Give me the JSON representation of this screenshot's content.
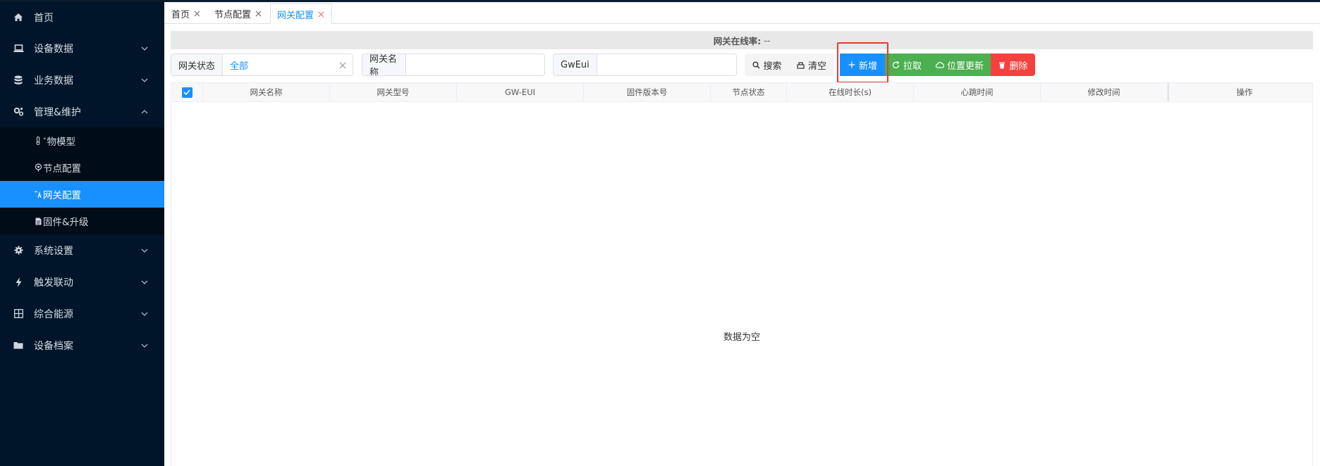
{
  "sidebar": {
    "items": [
      {
        "label": "首页",
        "icon": "home-icon",
        "has_chevron": false
      },
      {
        "label": "设备数据",
        "icon": "laptop-icon",
        "has_chevron": true
      },
      {
        "label": "业务数据",
        "icon": "database-icon",
        "has_chevron": true
      },
      {
        "label": "管理&维护",
        "icon": "cogs-icon",
        "has_chevron": true,
        "expanded": true
      }
    ],
    "sub_items": [
      {
        "label": "物模型",
        "icon": "thermometer-icon",
        "icon_glyph": "🌡"
      },
      {
        "label": "节点配置",
        "icon": "node-icon",
        "icon_glyph": "◎"
      },
      {
        "label": "网关配置",
        "icon": "gateway-icon",
        "icon_glyph": "⟟",
        "active": true
      },
      {
        "label": "固件&升级",
        "icon": "file-icon",
        "icon_glyph": "▤"
      }
    ],
    "items_after": [
      {
        "label": "系统设置",
        "icon": "gear-icon"
      },
      {
        "label": "触发联动",
        "icon": "bolt-icon"
      },
      {
        "label": "综合能源",
        "icon": "grid-icon"
      },
      {
        "label": "设备档案",
        "icon": "folder-icon"
      }
    ]
  },
  "tabs": [
    {
      "label": "首页"
    },
    {
      "label": "节点配置"
    },
    {
      "label": "网关配置",
      "active": true
    }
  ],
  "rate": {
    "label": "网关在线率:",
    "value": "--"
  },
  "filters": {
    "status_label": "网关状态",
    "status_value": "全部",
    "name_label": "网关名称",
    "name_value": "",
    "gweui_label": "GwEui",
    "gweui_value": ""
  },
  "buttons": {
    "search": "搜索",
    "clear": "清空",
    "add": "新增",
    "pull": "拉取",
    "location": "位置更新",
    "delete": "删除"
  },
  "table": {
    "columns": [
      "网关名称",
      "网关型号",
      "GW-EUI",
      "固件版本号",
      "节点状态",
      "在线时长(s)",
      "心跳时间",
      "修改时间",
      "操作"
    ],
    "empty_text": "数据为空"
  },
  "colors": {
    "sidebar_bg": "#001529",
    "primary": "#1890ff",
    "success": "#4caf50",
    "danger": "#f5413e",
    "highlight": "#e53935"
  }
}
